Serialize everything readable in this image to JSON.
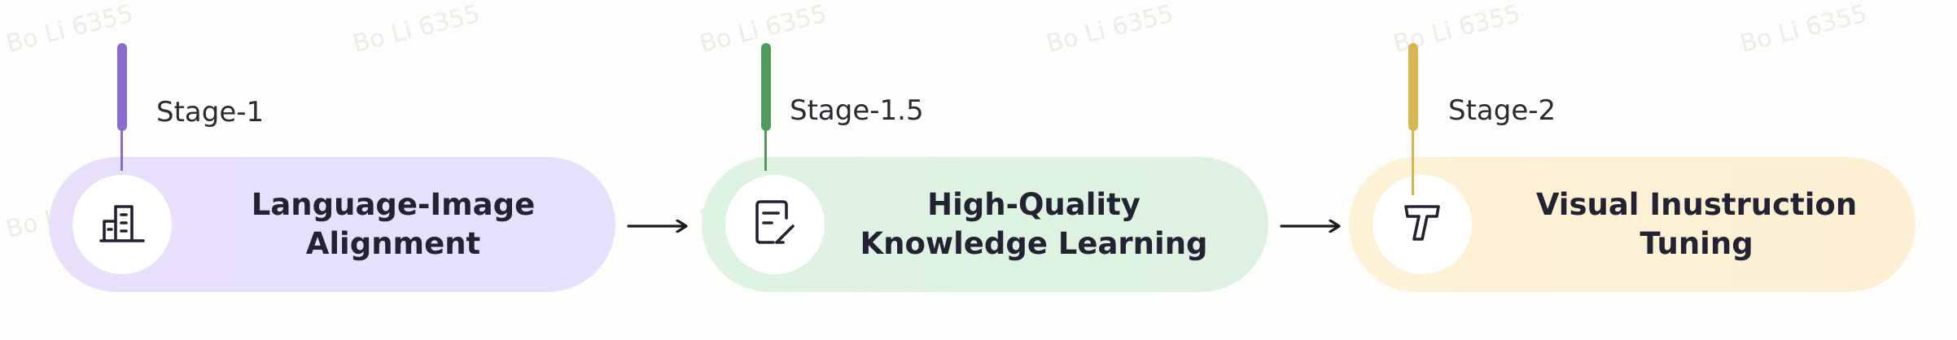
{
  "watermark_text": "Bo Li 6355",
  "stages": [
    {
      "label": "Stage-1",
      "title": "Language-Image Alignment",
      "icon": "building-icon",
      "accent": "#8b6ad0",
      "background": "#e8e0fb"
    },
    {
      "label": "Stage-1.5",
      "title_line1": "High-Quality",
      "title_line2": "Knowledge Learning",
      "icon": "document-edit-icon",
      "accent": "#4f9a5c",
      "background": "#dff3e3"
    },
    {
      "label": "Stage-2",
      "title": "Visual Inustruction Tuning",
      "icon": "text-tool-icon",
      "accent": "#d8b452",
      "background": "#fdf1d6"
    }
  ],
  "connector_icon": "right-arrow-icon"
}
